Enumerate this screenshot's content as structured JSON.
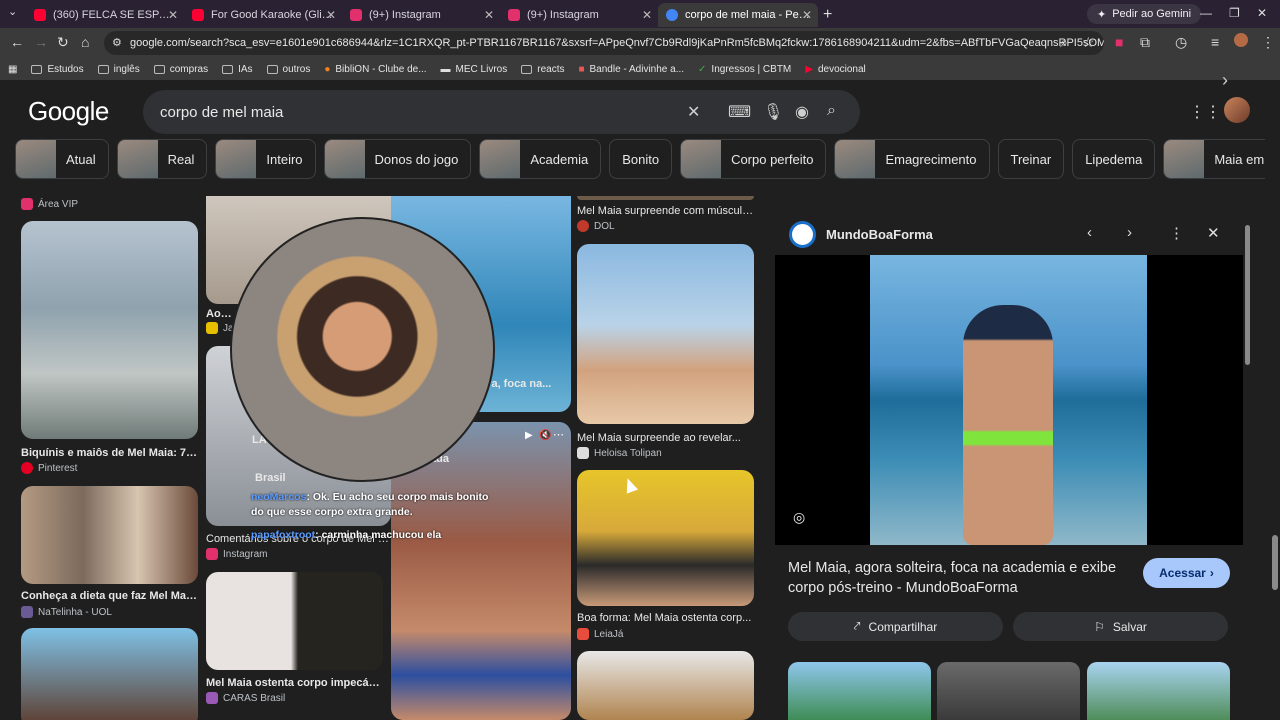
{
  "browser": {
    "tabs": [
      {
        "label": "(360) FELCA SE ESPANTOU COM",
        "color": "#ff0033"
      },
      {
        "label": "For Good Karaoke (Glinda Part",
        "color": "#ff0033"
      },
      {
        "label": "(9+) Instagram",
        "color": "#e1306c"
      },
      {
        "label": "(9+) Instagram",
        "color": "#e1306c"
      },
      {
        "label": "corpo de mel maia - Pesquisa G",
        "color": "#4285f4"
      }
    ],
    "gemini_label": "Pedir ao Gemini",
    "url": "google.com/search?sca_esv=e1601e901c686944&rlz=1C1RXQR_pt-PTBR1167BR1167&sxsrf=APpeQnvf7Cb9Rdl9jKaPnRm5fcBMq2fckw:1786168904211&udm=2&fbs=ABfTbFVGaQeaqnsRPI5sOMG32KszkLt6nAp8aiRKj5vMj...",
    "bookmarks": [
      "Estudos",
      "inglês",
      "compras",
      "IAs",
      "outros",
      "BibliON - Clube de...",
      "MEC Livros",
      "reacts",
      "Bandle - Adivinhe a...",
      "Ingressos | CBTM",
      "devocional"
    ]
  },
  "google": {
    "logo": "Google",
    "query": "corpo de mel maia",
    "chips": [
      "Atual",
      "Real",
      "Inteiro",
      "Donos do jogo",
      "Academia",
      "Bonito",
      "Corpo perfeito",
      "Emagrecimento",
      "Treinar",
      "Lipedema",
      "Maia em"
    ]
  },
  "results": {
    "col1": [
      {
        "caption": "Área VIP"
      },
      {
        "caption": "Biquínis e maiôs de Mel Maia: 7 qu...",
        "source": "Pinterest"
      },
      {
        "caption": "Conheça a dieta que faz Mel Maia...",
        "source": "NaTelinha - UOL"
      }
    ],
    "col2": [
      {
        "caption": "Aos 15",
        "source": "Ja"
      },
      {
        "caption": "LA",
        "source": "Brasil"
      },
      {
        "caption": "Comentários sobre o corpo de Mel Maia",
        "source": "Instagram"
      },
      {
        "caption": "Mel Maia ostenta corpo impecável...",
        "source": "CARAS Brasil"
      }
    ],
    "col2b": [
      {
        "caption": "eira, foca na..."
      },
      {
        "caption": "ada"
      }
    ],
    "col3": [
      {
        "caption": "Mel Maia surpreende com músculo...",
        "source": "DOL"
      },
      {
        "caption": "Mel Maia surpreende ao revelar...",
        "source": "Heloisa Tolipan"
      },
      {
        "caption": "Boa forma: Mel Maia ostenta corp...",
        "source": "LeiaJá"
      }
    ]
  },
  "overlay_chat": [
    {
      "user": "neoMarcos",
      "text": ": Ok. Eu acho seu corpo mais bonito do que esse corpo extra grande."
    },
    {
      "user": "papafoxtroot",
      "text": ": carminha machucou ela"
    }
  ],
  "panel": {
    "site": "MundoBoaForma",
    "headline": "Mel Maia, agora solteira, foca na academia e exibe corpo pós-treino - MundoBoaForma",
    "visit_label": "Acessar",
    "share_label": "Compartilhar",
    "save_label": "Salvar"
  }
}
